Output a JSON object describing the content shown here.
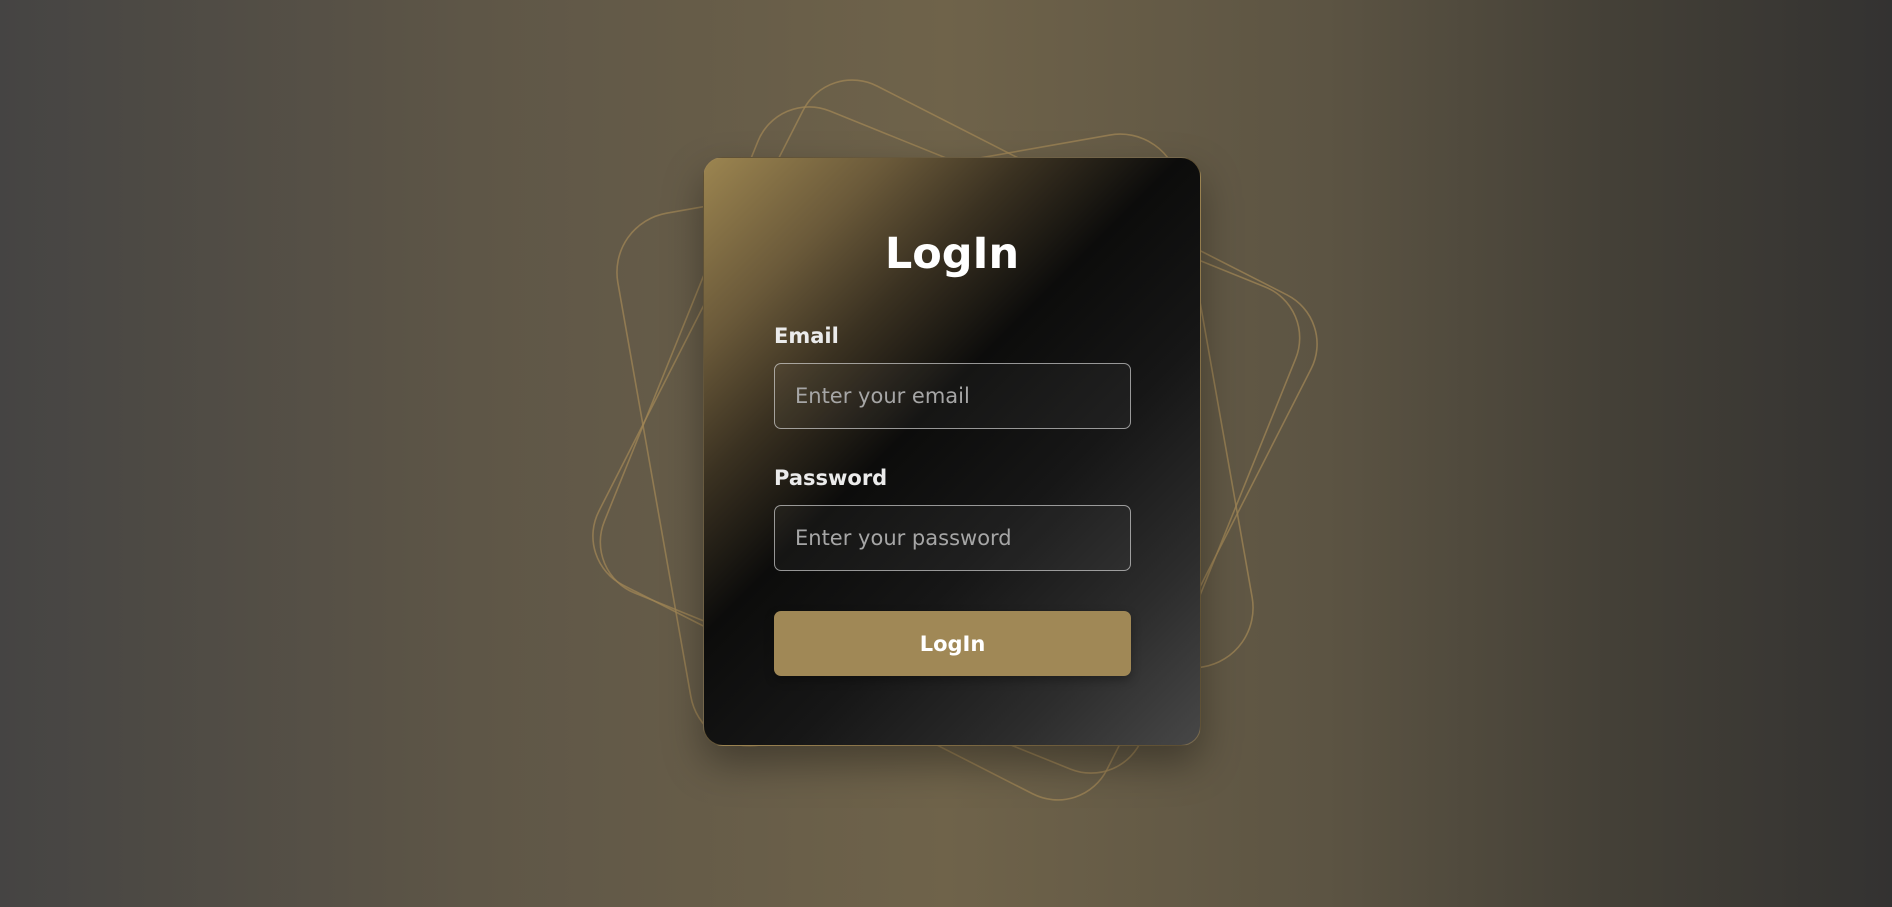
{
  "page": {
    "title": "LogIn"
  },
  "form": {
    "email_label": "Email",
    "email_placeholder": "Enter your email",
    "email_value": "",
    "password_label": "Password",
    "password_placeholder": "Enter your password",
    "password_value": "",
    "submit_label": "LogIn"
  },
  "colors": {
    "accent": "#a08856",
    "card_dark": "#0c0c0b",
    "decoration_stroke": "#a08656"
  }
}
